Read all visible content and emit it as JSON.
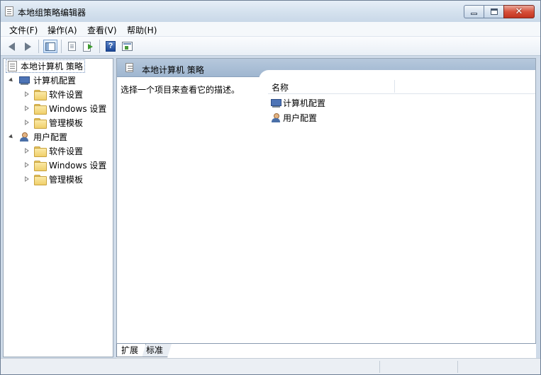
{
  "window": {
    "title": "本地组策略编辑器"
  },
  "menu": {
    "items": [
      "文件(F)",
      "操作(A)",
      "查看(V)",
      "帮助(H)"
    ]
  },
  "toolbar": {
    "buttons": [
      "back-icon",
      "forward-icon",
      "show-hide-console-tree-icon",
      "properties-icon",
      "export-list-icon",
      "help-icon",
      "show-action-pane-icon"
    ]
  },
  "tree": {
    "root": "本地计算机 策略",
    "computer": {
      "label": "计算机配置",
      "children": [
        "软件设置",
        "Windows 设置",
        "管理模板"
      ]
    },
    "user": {
      "label": "用户配置",
      "children": [
        "软件设置",
        "Windows 设置",
        "管理模板"
      ]
    }
  },
  "details": {
    "header": "本地计算机 策略",
    "description": "选择一个项目来查看它的描述。",
    "column_name": "名称",
    "rows": [
      "计算机配置",
      "用户配置"
    ]
  },
  "tabs": [
    "扩展",
    "标准"
  ]
}
